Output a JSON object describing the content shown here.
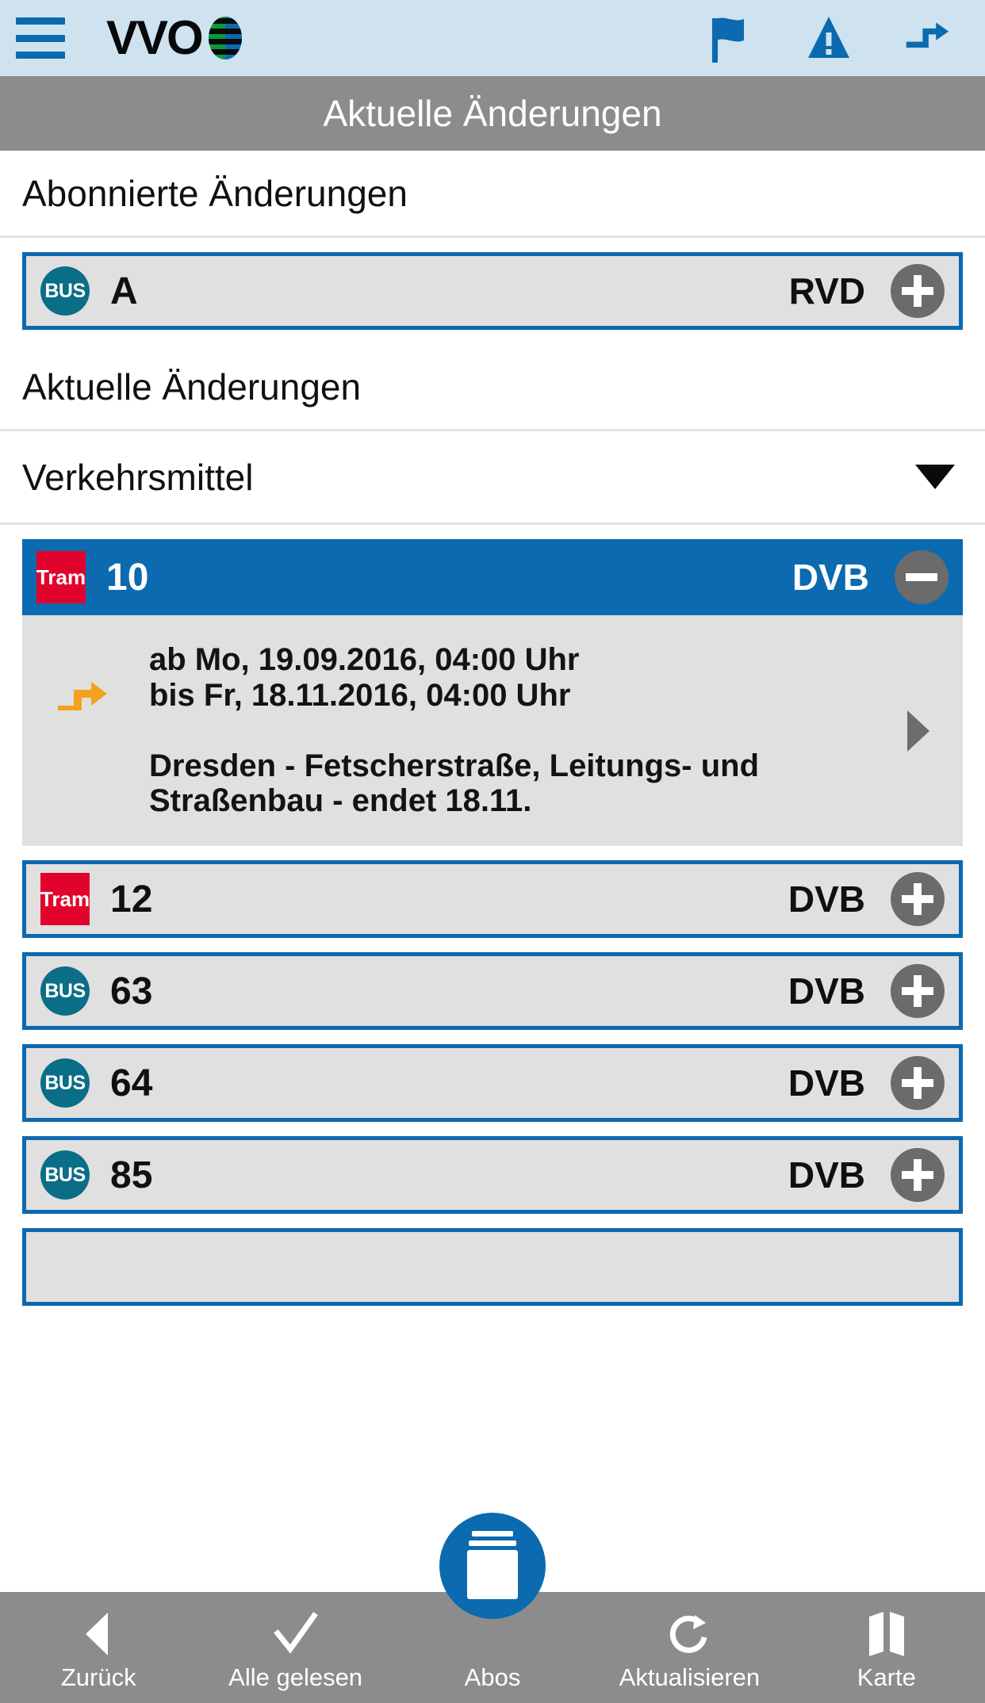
{
  "app": {
    "brand": "VVO",
    "menu_icon": "hamburger-icon",
    "logo_mark_icon": "vvo-globe-icon"
  },
  "header": {
    "actions": [
      {
        "name": "flag-icon",
        "label": "Flag"
      },
      {
        "name": "warning-triangle-icon",
        "label": "Warnung"
      },
      {
        "name": "detour-arrow-icon",
        "label": "Umleitung"
      }
    ]
  },
  "titlebar": {
    "title": "Aktuelle Änderungen"
  },
  "sections": {
    "subscribed": {
      "heading": "Abonnierte Änderungen"
    },
    "current": {
      "heading": "Aktuelle Änderungen"
    }
  },
  "filter": {
    "label": "Verkehrsmittel",
    "caret_icon": "chevron-down-icon"
  },
  "subscribed_rows": [
    {
      "mode": "BUS",
      "line": "A",
      "operator": "RVD",
      "action": "plus"
    }
  ],
  "expanded_card": {
    "mode": "Tram",
    "line": "10",
    "operator": "DVB",
    "action": "minus",
    "detour_icon": "detour-arrow-icon",
    "valid_from": "ab Mo, 19.09.2016, 04:00 Uhr",
    "valid_to": "bis Fr, 18.11.2016, 04:00 Uhr",
    "description_line1": "Dresden - Fetscherstraße, Leitungs- und",
    "description_line2": "Straßenbau - endet 18.11.",
    "detail_arrow_icon": "chevron-right-icon"
  },
  "current_rows": [
    {
      "mode": "Tram",
      "line": "12",
      "operator": "DVB",
      "action": "plus"
    },
    {
      "mode": "BUS",
      "line": "63",
      "operator": "DVB",
      "action": "plus"
    },
    {
      "mode": "BUS",
      "line": "64",
      "operator": "DVB",
      "action": "plus"
    },
    {
      "mode": "BUS",
      "line": "85",
      "operator": "DVB",
      "action": "plus"
    },
    {
      "mode": "",
      "line": "",
      "operator": "",
      "action": ""
    }
  ],
  "bottomnav": {
    "items": [
      {
        "label": "Zurück",
        "icon": "back-triangle-icon"
      },
      {
        "label": "Alle gelesen",
        "icon": "check-icon"
      },
      {
        "label": "Abos",
        "icon": "card-stack-icon"
      },
      {
        "label": "Aktualisieren",
        "icon": "refresh-icon"
      },
      {
        "label": "Karte",
        "icon": "map-icon"
      }
    ]
  },
  "colors": {
    "header_bg": "#cfe2f0",
    "accent_blue": "#0b6ab0",
    "titlebar_gray": "#8c8c8c",
    "row_gray": "#e0e0e0",
    "bus_teal": "#0a6e86",
    "tram_red": "#e2032c",
    "btn_gray": "#6b6b6b",
    "detour_orange": "#f5a01e"
  }
}
